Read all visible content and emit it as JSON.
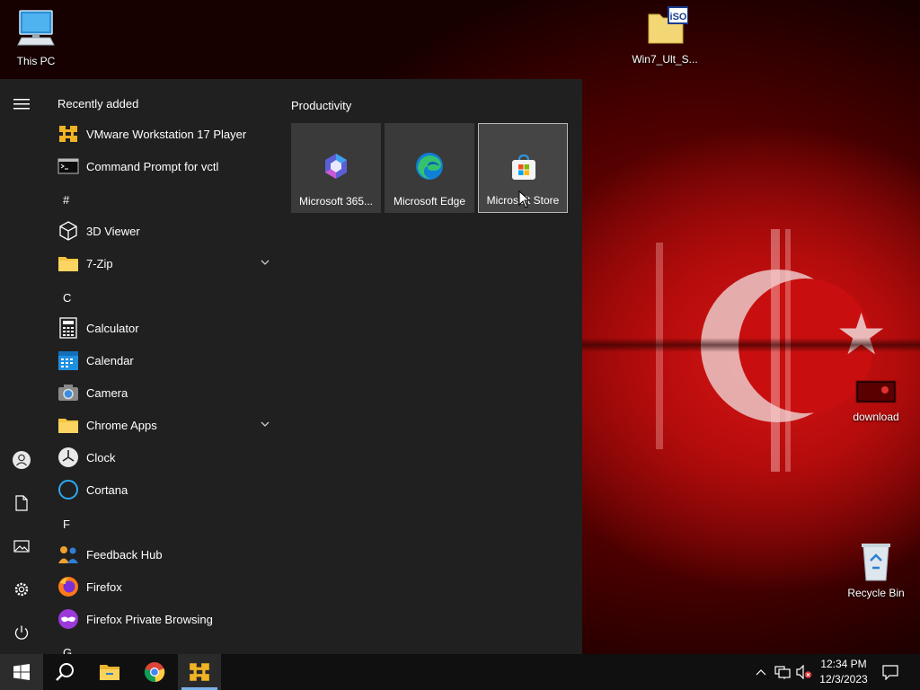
{
  "desktop": {
    "icons": [
      {
        "label": "This PC",
        "icon": "computer-icon"
      },
      {
        "label": "Win7_Ult_S...",
        "icon": "iso-file-icon",
        "badge": "iSO"
      },
      {
        "label": "download",
        "icon": "image-file-icon"
      },
      {
        "label": "Recycle Bin",
        "icon": "recycle-bin-icon"
      }
    ]
  },
  "start_menu": {
    "list_header": "Recently added",
    "rail": [
      {
        "icon": "hamburger-menu-icon"
      },
      {
        "icon": "user-account-icon"
      },
      {
        "icon": "documents-icon"
      },
      {
        "icon": "pictures-icon"
      },
      {
        "icon": "settings-gear-icon"
      },
      {
        "icon": "power-icon"
      }
    ],
    "apps": [
      {
        "label": "VMware Workstation 17 Player",
        "icon": "vmware-icon"
      },
      {
        "label": "Command Prompt for vctl",
        "icon": "command-prompt-icon"
      },
      {
        "letter": "#"
      },
      {
        "label": "3D Viewer",
        "icon": "3d-cube-icon"
      },
      {
        "label": "7-Zip",
        "icon": "folder-icon",
        "expandable": true
      },
      {
        "letter": "C"
      },
      {
        "label": "Calculator",
        "icon": "calculator-icon"
      },
      {
        "label": "Calendar",
        "icon": "calendar-icon"
      },
      {
        "label": "Camera",
        "icon": "camera-icon"
      },
      {
        "label": "Chrome Apps",
        "icon": "folder-icon",
        "expandable": true
      },
      {
        "label": "Clock",
        "icon": "clock-icon"
      },
      {
        "label": "Cortana",
        "icon": "cortana-ring-icon"
      },
      {
        "letter": "F"
      },
      {
        "label": "Feedback Hub",
        "icon": "feedback-hub-icon"
      },
      {
        "label": "Firefox",
        "icon": "firefox-icon"
      },
      {
        "label": "Firefox Private Browsing",
        "icon": "firefox-private-icon"
      },
      {
        "letter": "G"
      }
    ],
    "tiles_group": "Productivity",
    "tiles": [
      {
        "label": "Microsoft 365...",
        "icon": "microsoft-365-icon"
      },
      {
        "label": "Microsoft Edge",
        "icon": "edge-icon"
      },
      {
        "label": "Microsoft Store",
        "icon": "store-bag-icon",
        "hovered": true
      }
    ]
  },
  "taskbar": {
    "buttons": [
      {
        "icon": "windows-start-icon"
      },
      {
        "icon": "search-icon"
      },
      {
        "icon": "file-explorer-icon"
      },
      {
        "icon": "chrome-icon"
      },
      {
        "icon": "vmware-icon",
        "active": true
      }
    ],
    "tray": [
      {
        "icon": "chevron-up-icon"
      },
      {
        "icon": "network-icon"
      },
      {
        "icon": "volume-muted-icon"
      }
    ],
    "time": "12:34 PM",
    "date": "12/3/2023",
    "notification_icon": "action-center-icon"
  },
  "colors": {
    "start_bg": "#202020",
    "taskbar_bg": "#101010",
    "accent": "#7ab0e8",
    "wallpaper_red": "#c80e0e"
  }
}
